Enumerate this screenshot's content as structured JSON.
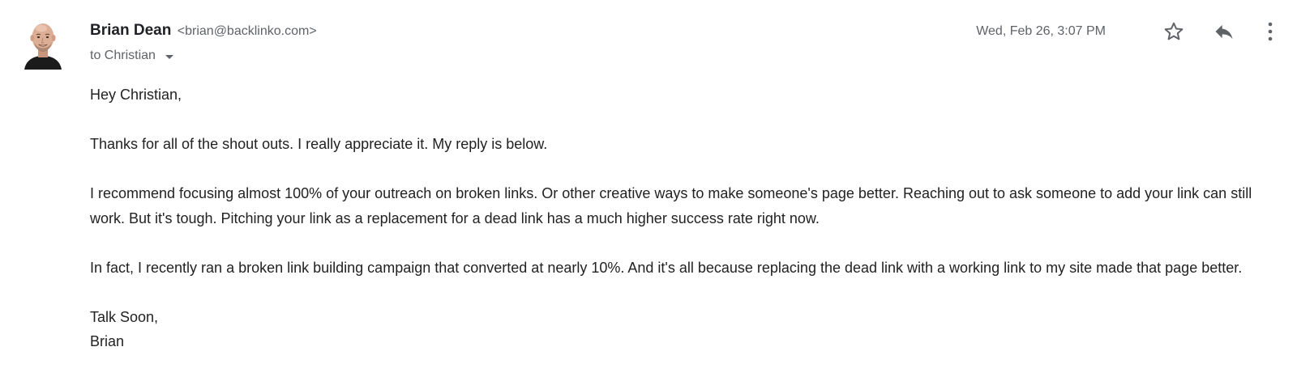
{
  "header": {
    "sender_name": "Brian Dean",
    "sender_email": "<brian@backlinko.com>",
    "recipient": "to Christian",
    "timestamp": "Wed, Feb 26, 3:07 PM"
  },
  "actions": {
    "star_icon": "star-outline",
    "reply_icon": "reply-arrow",
    "more_icon": "vertical-dots"
  },
  "body": {
    "greeting": "Hey Christian,",
    "paragraph_1": "Thanks for all of the shout outs. I really appreciate it. My reply is below.",
    "paragraph_2": "I recommend focusing almost 100% of your outreach on broken links. Or other creative ways to make someone's page better. Reaching out to ask someone to add your link can still work. But it's tough. Pitching your link as a replacement for a dead link has a much higher success rate right now.",
    "paragraph_3": "In fact, I recently ran a broken link building campaign that converted at nearly 10%. And it's all because replacing the dead link with a working link to my site made that page better.",
    "closing": "Talk Soon,",
    "signature": "Brian"
  },
  "colors": {
    "text": "#222222",
    "secondary_text": "#5f6368",
    "background": "#ffffff"
  }
}
